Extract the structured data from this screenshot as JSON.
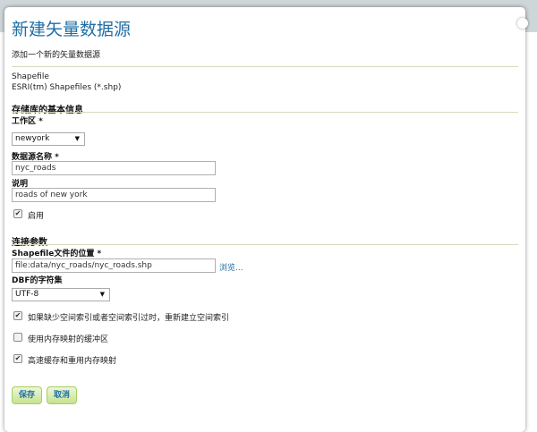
{
  "page": {
    "title": "新建矢量数据源",
    "subtitle": "添加一个新的矢量数据源"
  },
  "datasource": {
    "type_name": "Shapefile",
    "type_description": "ESRI(tm) Shapefiles (*.shp)"
  },
  "basic_info": {
    "heading": "存储库的基本信息",
    "workspace_label": "工作区 *",
    "workspace_value": "newyork",
    "name_label": "数据源名称 *",
    "name_value": "nyc_roads",
    "description_label": "说明",
    "description_value": "roads of new york",
    "enabled_label": "启用",
    "enabled_checked": true
  },
  "connection": {
    "heading": "连接参数",
    "shapefile_label": "Shapefile文件的位置 *",
    "shapefile_value": "file:data/nyc_roads/nyc_roads.shp",
    "browse_label": "浏览...",
    "charset_label": "DBF的字符集",
    "charset_value": "UTF-8",
    "options": [
      {
        "label": "如果缺少空间索引或者空间索引过时，重新建立空间索引",
        "checked": true
      },
      {
        "label": "使用内存映射的缓冲区",
        "checked": false
      },
      {
        "label": "高速缓存和重用内存映射",
        "checked": true
      }
    ]
  },
  "buttons": {
    "save": "保存",
    "cancel": "取消"
  },
  "icons": {
    "checkmark": "✔",
    "dropdown": "▼"
  }
}
